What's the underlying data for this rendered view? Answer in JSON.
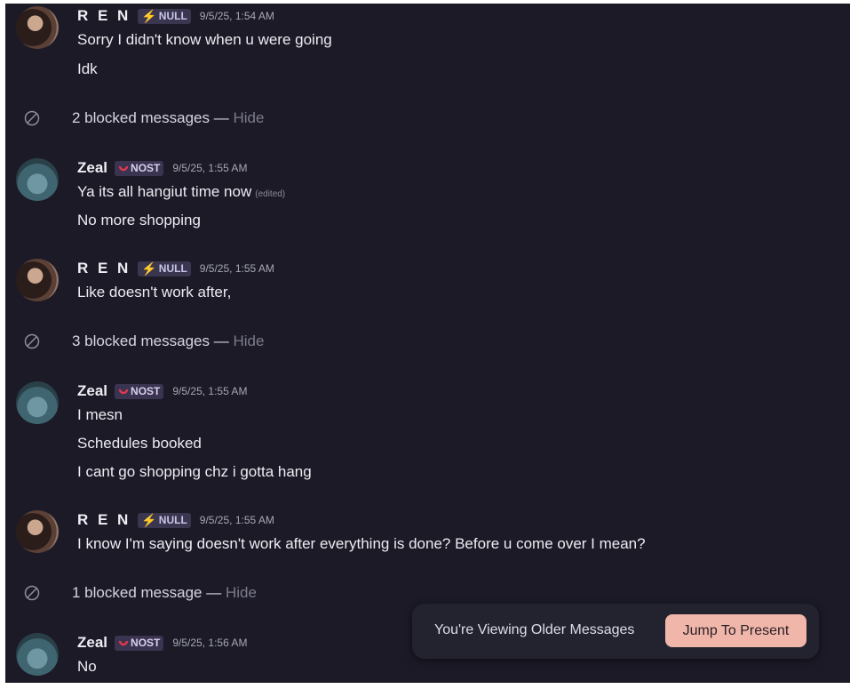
{
  "messages": [
    {
      "author": "R E N",
      "tag": "NULL",
      "time": "9/5/25, 1:54 AM",
      "lines": [
        "Sorry I didn't know when u were going",
        "Idk"
      ]
    },
    {
      "blocked": "2 blocked messages",
      "sep": "—",
      "hide": "Hide"
    },
    {
      "author": "Zeal",
      "tag": "NOST",
      "time": "9/5/25, 1:55 AM",
      "lines": [
        "Ya its all hangiut time now",
        "No more shopping"
      ],
      "edited": "(edited)"
    },
    {
      "author": "R E N",
      "tag": "NULL",
      "time": "9/5/25, 1:55 AM",
      "lines": [
        "Like doesn't work after,"
      ]
    },
    {
      "blocked": "3 blocked messages",
      "sep": "—",
      "hide": "Hide"
    },
    {
      "author": "Zeal",
      "tag": "NOST",
      "time": "9/5/25, 1:55 AM",
      "lines": [
        "I mesn",
        "Schedules booked",
        "I cant go shopping chz i gotta hang"
      ]
    },
    {
      "author": "R E N",
      "tag": "NULL",
      "time": "9/5/25, 1:55 AM",
      "lines": [
        "I know I'm saying doesn't work after everything is done? Before u come over I mean?"
      ]
    },
    {
      "blocked": "1 blocked message",
      "sep": "—",
      "hide": "Hide"
    },
    {
      "author": "Zeal",
      "tag": "NOST",
      "time": "9/5/25, 1:56 AM",
      "lines": [
        "No"
      ]
    }
  ],
  "toast": {
    "text": "You're Viewing Older Messages",
    "button": "Jump To Present"
  },
  "colors": {
    "background": "#1b1a26",
    "accent": "#f1b6aa",
    "null_bolt": "#f2c54a",
    "nost_swirl": "#e0394e"
  },
  "icons": {
    "blocked": "blocked-icon",
    "null_tag": "lightning-bolt-icon",
    "nost_tag": "swirl-icon"
  }
}
